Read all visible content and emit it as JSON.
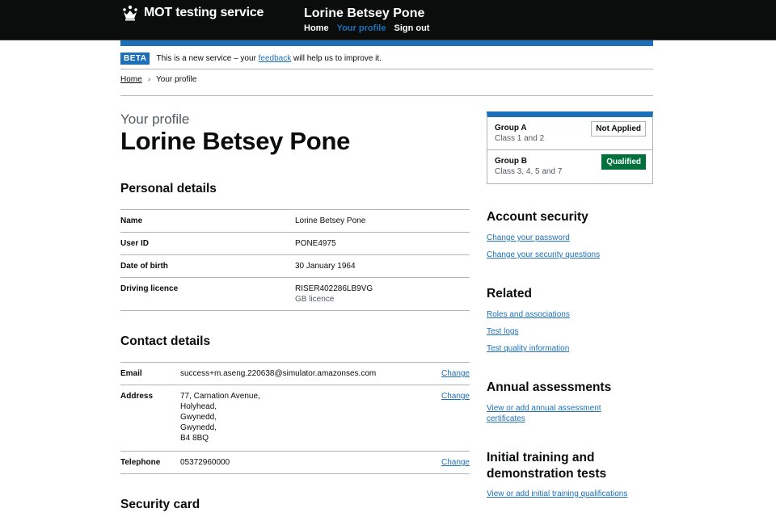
{
  "header": {
    "service_name": "MOT testing service",
    "user_name": "Lorine Betsey Pone",
    "nav": [
      {
        "label": "Home",
        "active": false
      },
      {
        "label": "Your profile",
        "active": true
      },
      {
        "label": "Sign out",
        "active": false
      }
    ]
  },
  "phase_banner": {
    "tag": "BETA",
    "text_before": "This is a new service – your",
    "link": "feedback",
    "text_after": "will help us to improve it."
  },
  "breadcrumb": {
    "home": "Home",
    "current": "Your profile"
  },
  "page": {
    "caption": "Your profile",
    "title": "Lorine Betsey Pone"
  },
  "personal_details": {
    "heading": "Personal details",
    "rows": [
      {
        "key": "Name",
        "value": "Lorine Betsey Pone",
        "sub": ""
      },
      {
        "key": "User ID",
        "value": "PONE4975",
        "sub": ""
      },
      {
        "key": "Date of birth",
        "value": "30 January 1964",
        "sub": ""
      },
      {
        "key": "Driving licence",
        "value": "RISER402286LB9VG",
        "sub": "GB licence"
      }
    ]
  },
  "contact_details": {
    "heading": "Contact details",
    "rows": [
      {
        "key": "Email",
        "value": "success+m.aseng.220638@simulator.amazonses.com",
        "action": "Change"
      },
      {
        "key": "Address",
        "lines": [
          "77, Carnation Avenue,",
          "Holyhead,",
          "Gwynedd,",
          "Gwynedd,",
          "B4 8BQ"
        ],
        "action": "Change"
      },
      {
        "key": "Telephone",
        "value": "05372960000",
        "action": "Change"
      }
    ]
  },
  "security_card": {
    "heading": "Security card"
  },
  "qualifications": [
    {
      "group": "Group A",
      "classes": "Class 1 and 2",
      "status": "Not Applied"
    },
    {
      "group": "Group B",
      "classes": "Class 3, 4, 5 and 7",
      "status": "Qualified"
    }
  ],
  "account_security": {
    "heading": "Account security",
    "links": [
      "Change your password",
      "Change your security questions"
    ]
  },
  "related": {
    "heading": "Related",
    "links": [
      "Roles and associations",
      "Test logs",
      "Test quality information"
    ]
  },
  "annual_assessments": {
    "heading": "Annual assessments",
    "link_line1": "View or add annual assessment",
    "link_line2": "certificates"
  },
  "initial_training": {
    "heading_line1": "Initial training and",
    "heading_line2": "demonstration tests",
    "link": "View or add initial training qualifications"
  },
  "colors": {
    "header_bg": "#0b0c0c",
    "link": "#1d70b8",
    "qualified": "#00703c"
  }
}
